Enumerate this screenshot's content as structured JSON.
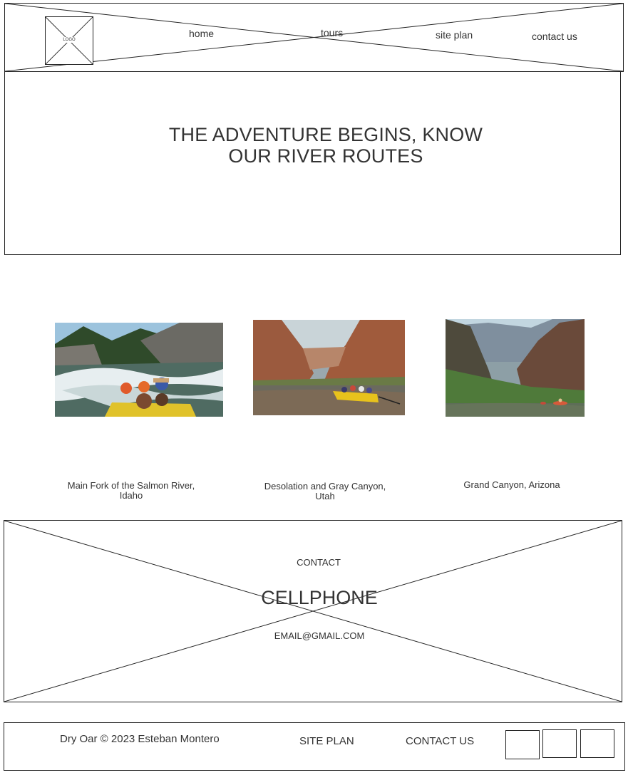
{
  "header": {
    "logo_text": "LOGO",
    "nav": [
      {
        "label": "home"
      },
      {
        "label": "tours"
      },
      {
        "label": "site plan"
      },
      {
        "label": "contact us"
      }
    ]
  },
  "hero": {
    "title_line1": "THE ADVENTURE BEGINS, KNOW",
    "title_line2": "OUR RIVER ROUTES"
  },
  "tours": [
    {
      "caption_line1": "Main Fork of the Salmon River,",
      "caption_line2": "Idaho",
      "image": "river-rafting-photo"
    },
    {
      "caption_line1": "Desolation and Gray Canyon,",
      "caption_line2": "Utah",
      "image": "canyon-raft-photo"
    },
    {
      "caption_line1": "Grand Canyon, Arizona",
      "caption_line2": "",
      "image": "grand-canyon-photo"
    }
  ],
  "contact": {
    "heading": "CONTACT",
    "phone": "CELLPHONE",
    "email": "EMAIL@GMAIL.COM"
  },
  "footer": {
    "copyright": "Dry Oar © 2023 Esteban Montero",
    "site_plan": "SITE PLAN",
    "contact_us": "CONTACT US",
    "social_icons": [
      "social-icon-placeholder",
      "social-icon-placeholder",
      "social-icon-placeholder"
    ]
  }
}
